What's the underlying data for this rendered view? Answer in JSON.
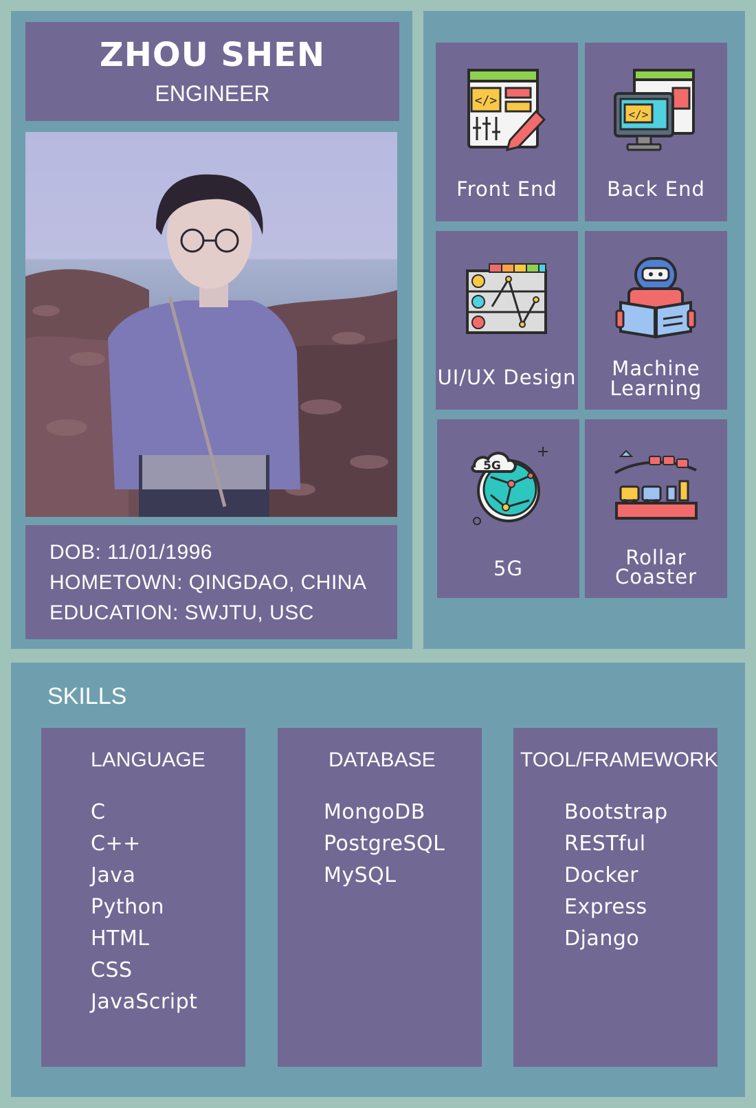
{
  "profile": {
    "name": "ZHOU SHEN",
    "role": "ENGINEER",
    "dob": "DOB: 11/01/1996",
    "hometown": "HOMETOWN: QINGDAO, CHINA",
    "education": "EDUCATION: SWJTU, USC"
  },
  "interests": [
    {
      "label": "Front End",
      "icon": "front-end-icon"
    },
    {
      "label": "Back End",
      "icon": "back-end-icon"
    },
    {
      "label": "UI/UX Design",
      "icon": "ui-ux-design-icon"
    },
    {
      "label_line1": "Machine",
      "label_line2": "Learning",
      "icon": "machine-learning-icon"
    },
    {
      "label": "5G",
      "icon": "5g-globe-icon",
      "badge": "5G"
    },
    {
      "label_line1": "Rollar",
      "label_line2": "Coaster",
      "icon": "roller-coaster-icon"
    }
  ],
  "skills": {
    "title": "SKILLS",
    "columns": [
      {
        "heading": "LANGUAGE",
        "items": [
          "C",
          "C++",
          "Java",
          "Python",
          "HTML",
          "CSS",
          "JavaScript"
        ]
      },
      {
        "heading": "DATABASE",
        "items": [
          "MongoDB",
          "PostgreSQL",
          "MySQL"
        ]
      },
      {
        "heading": "TOOL/FRAMEWORK",
        "items": [
          "Bootstrap",
          "RESTful",
          "Docker",
          "Express",
          "Django"
        ]
      }
    ]
  },
  "colors": {
    "background": "#9fc3b8",
    "panel": "#6f9fae",
    "box": "#726894",
    "text": "#ffffff"
  }
}
